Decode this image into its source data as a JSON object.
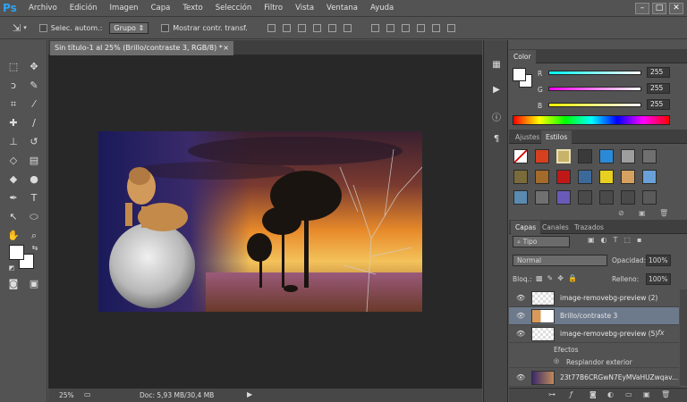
{
  "app": {
    "logo": "Ps"
  },
  "menu": [
    "Archivo",
    "Edición",
    "Imagen",
    "Capa",
    "Texto",
    "Selección",
    "Filtro",
    "Vista",
    "Ventana",
    "Ayuda"
  ],
  "window_controls": [
    "–",
    "□",
    "✕"
  ],
  "options": {
    "auto_select_label": "Selec. autom.:",
    "auto_select_value": "Grupo",
    "show_transform_label": "Mostrar contr. transf."
  },
  "document": {
    "tab_title": "Sin título-1 al 25% (Brillo/contraste 3, RGB/8) *",
    "tab_close": "×"
  },
  "status": {
    "zoom": "25%",
    "doc_info": "Doc: 5,93 MB/30,4 MB"
  },
  "color_panel": {
    "tab": "Color",
    "r_label": "R",
    "r_value": "255",
    "g_label": "G",
    "g_value": "255",
    "b_label": "B",
    "b_value": "255"
  },
  "styles_panel": {
    "tabs": [
      "Ajustes",
      "Estilos"
    ],
    "active": "Estilos",
    "swatches": [
      "#ffffff",
      "#d6401f",
      "#c8b36a",
      "#3a3a3a",
      "#2b8ad8",
      "#9e9e9e",
      "#707070",
      "#7a6b3a",
      "#a36a2a",
      "#c01818",
      "#3b6a9a",
      "#e8d020",
      "#d6a060",
      "#6aa0d8",
      "#5b8ab0",
      "#707070",
      "#6a5ab8",
      "#4a4a4a",
      "#4a4a4a",
      "#4a4a4a",
      "#5a5a5a"
    ]
  },
  "layers_panel": {
    "tabs": [
      "Capas",
      "Canales",
      "Trazados"
    ],
    "active": "Capas",
    "filter": "Tipo",
    "blend_mode": "Normal",
    "opacity_label": "Opacidad:",
    "opacity_value": "100%",
    "lock_label": "Bloq.:",
    "fill_label": "Relleno:",
    "fill_value": "100%",
    "layers": [
      {
        "name": "image-removebg-preview (2)"
      },
      {
        "name": "Brillo/contraste 3",
        "selected": true
      },
      {
        "name": "image-removebg-preview (5)",
        "fx": "fx"
      },
      {
        "name": "Efectos"
      },
      {
        "name": "Resplandor exterior"
      },
      {
        "name": "23t77B6CRGwN7EyMVaHUZwqav..."
      }
    ]
  }
}
